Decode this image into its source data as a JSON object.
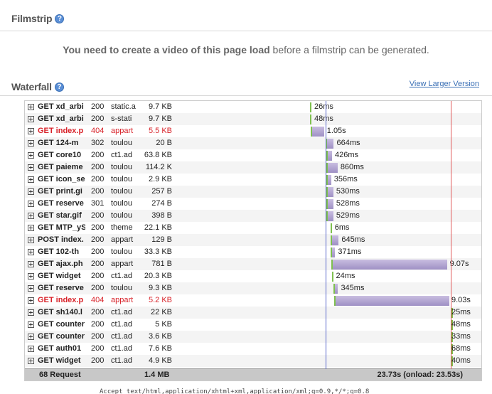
{
  "filmstrip": {
    "title": "Filmstrip",
    "help": "?",
    "message_bold": "You need to create a video of this page load",
    "message_rest": " before a filmstrip can be generated."
  },
  "waterfall": {
    "title": "Waterfall",
    "help": "?",
    "view_larger": "View Larger Version",
    "rows": [
      {
        "url": "GET xd_arbi",
        "status": "200",
        "domain": "static.a",
        "size": "9.7 KB",
        "time": "26ms",
        "start": 0.0,
        "dur": 0.026,
        "error": false
      },
      {
        "url": "GET xd_arbi",
        "status": "200",
        "domain": "s-stati",
        "size": "9.7 KB",
        "time": "48ms",
        "start": 0.0,
        "dur": 0.048,
        "error": false
      },
      {
        "url": "GET index.p",
        "status": "404",
        "domain": "appart",
        "size": "5.5 KB",
        "time": "1.05s",
        "start": 0.05,
        "dur": 1.05,
        "error": true
      },
      {
        "url": "GET 124-m",
        "status": "302",
        "domain": "toulou",
        "size": "20 B",
        "time": "664ms",
        "start": 1.2,
        "dur": 0.664,
        "error": false
      },
      {
        "url": "GET core10",
        "status": "200",
        "domain": "ct1.ad",
        "size": "63.8 KB",
        "time": "426ms",
        "start": 1.3,
        "dur": 0.426,
        "error": false
      },
      {
        "url": "GET paieme",
        "status": "200",
        "domain": "toulou",
        "size": "114.2 K",
        "time": "860ms",
        "start": 1.3,
        "dur": 0.86,
        "error": false
      },
      {
        "url": "GET icon_se",
        "status": "200",
        "domain": "toulou",
        "size": "2.9 KB",
        "time": "356ms",
        "start": 1.3,
        "dur": 0.356,
        "error": false
      },
      {
        "url": "GET print.gi",
        "status": "200",
        "domain": "toulou",
        "size": "257 B",
        "time": "530ms",
        "start": 1.3,
        "dur": 0.53,
        "error": false
      },
      {
        "url": "GET reserve",
        "status": "301",
        "domain": "toulou",
        "size": "274 B",
        "time": "528ms",
        "start": 1.3,
        "dur": 0.528,
        "error": false
      },
      {
        "url": "GET star.gif",
        "status": "200",
        "domain": "toulou",
        "size": "398 B",
        "time": "529ms",
        "start": 1.3,
        "dur": 0.529,
        "error": false
      },
      {
        "url": "GET MTP_yS",
        "status": "200",
        "domain": "theme",
        "size": "22.1 KB",
        "time": "6ms",
        "start": 1.6,
        "dur": 0.006,
        "error": false
      },
      {
        "url": "POST index.",
        "status": "200",
        "domain": "appart",
        "size": "129 B",
        "time": "645ms",
        "start": 1.6,
        "dur": 0.645,
        "error": false
      },
      {
        "url": "GET 102-th",
        "status": "200",
        "domain": "toulou",
        "size": "33.3 KB",
        "time": "371ms",
        "start": 1.6,
        "dur": 0.371,
        "error": false
      },
      {
        "url": "GET ajax.ph",
        "status": "200",
        "domain": "appart",
        "size": "781 B",
        "time": "9.07s",
        "start": 1.65,
        "dur": 9.07,
        "error": false
      },
      {
        "url": "GET widget",
        "status": "200",
        "domain": "ct1.ad",
        "size": "20.3 KB",
        "time": "24ms",
        "start": 1.7,
        "dur": 0.024,
        "error": false
      },
      {
        "url": "GET reserve",
        "status": "200",
        "domain": "toulou",
        "size": "9.3 KB",
        "time": "345ms",
        "start": 1.85,
        "dur": 0.345,
        "error": false
      },
      {
        "url": "GET index.p",
        "status": "404",
        "domain": "appart",
        "size": "5.2 KB",
        "time": "9.03s",
        "start": 1.9,
        "dur": 9.03,
        "error": true
      },
      {
        "url": "GET sh140.l",
        "status": "200",
        "domain": "ct1.ad",
        "size": "22 KB",
        "time": "25ms",
        "start": 11.1,
        "dur": 0.025,
        "error": false
      },
      {
        "url": "GET counter",
        "status": "200",
        "domain": "ct1.ad",
        "size": "5 KB",
        "time": "48ms",
        "start": 11.1,
        "dur": 0.048,
        "error": false
      },
      {
        "url": "GET counter",
        "status": "200",
        "domain": "ct1.ad",
        "size": "3.6 KB",
        "time": "33ms",
        "start": 11.1,
        "dur": 0.033,
        "error": false
      },
      {
        "url": "GET auth01",
        "status": "200",
        "domain": "ct1.ad",
        "size": "7.6 KB",
        "time": "68ms",
        "start": 11.1,
        "dur": 0.068,
        "error": false
      },
      {
        "url": "GET widget",
        "status": "200",
        "domain": "ct1.ad",
        "size": "4.9 KB",
        "time": "40ms",
        "start": 11.1,
        "dur": 0.04,
        "error": false
      }
    ],
    "summary": {
      "requests": "68 Request",
      "size": "1.4 MB",
      "time": "23.73s (onload: 23.53s)"
    },
    "dom_content_loaded": 1.25,
    "onload": 11.0,
    "axis_max": 13.3,
    "colors": {
      "blue_line": "#5563c8",
      "red_line": "#e05a5a",
      "error_text": "#d8232a",
      "link": "#3a6fb5"
    }
  },
  "truncated_text": "Accept  text/html,application/xhtml+xml,application/xml;q=0.9,*/*;q=0.8"
}
